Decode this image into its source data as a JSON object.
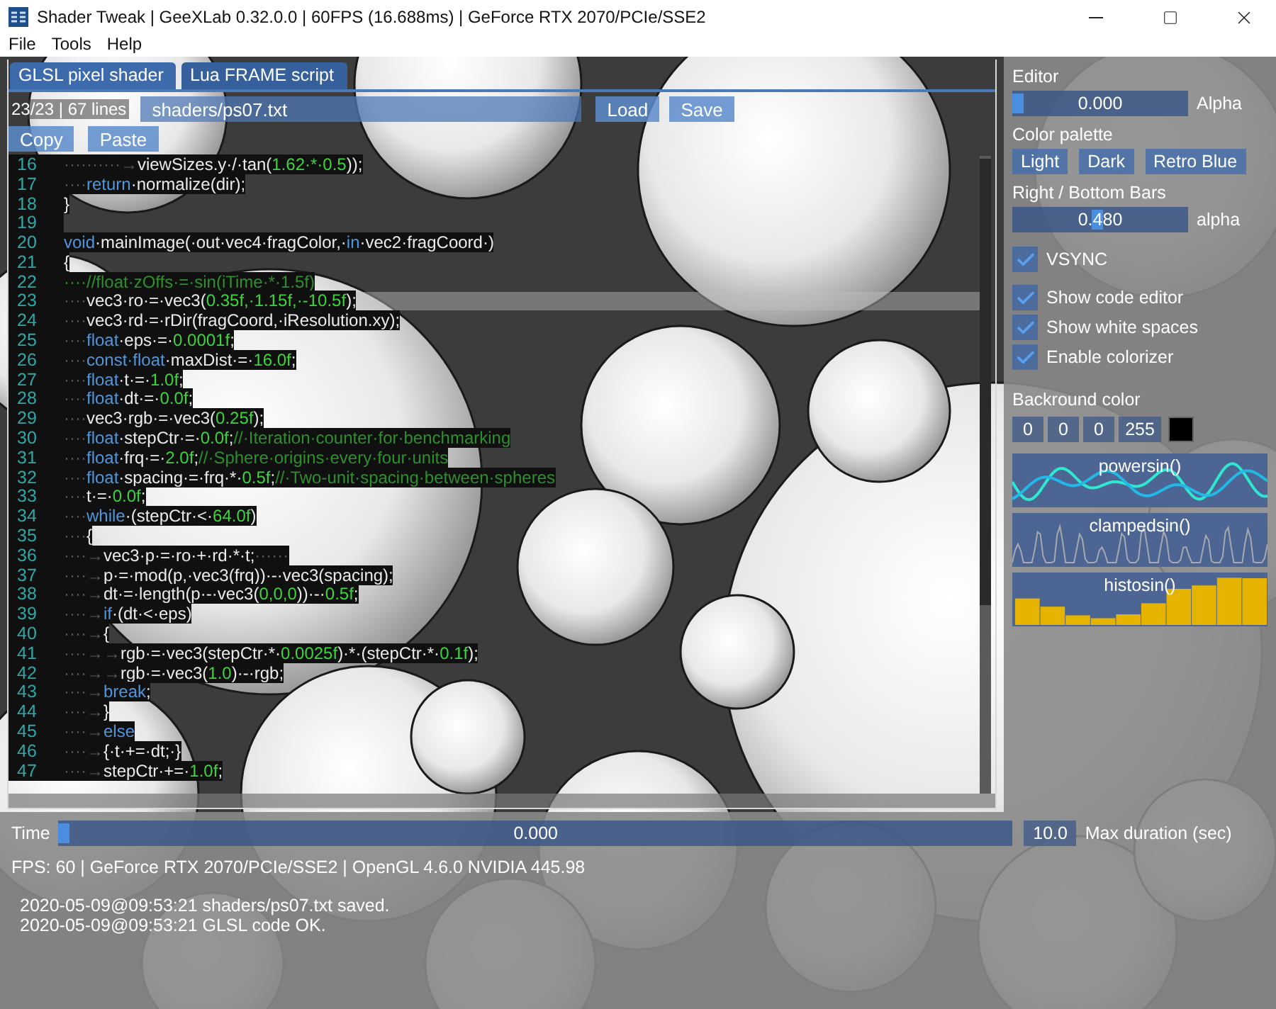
{
  "window": {
    "title": "Shader Tweak | GeeXLab 0.32.0.0 | 60FPS (16.688ms) | GeForce RTX 2070/PCIe/SSE2"
  },
  "menu": [
    "File",
    "Tools",
    "Help"
  ],
  "editor": {
    "tabs": [
      {
        "label": "GLSL pixel shader",
        "selected": true
      },
      {
        "label": "Lua FRAME script",
        "selected": false
      }
    ],
    "line_info": "23/23 | 67 lines",
    "file_path": "shaders/ps07.txt",
    "file_buttons": [
      "Load",
      "Save"
    ],
    "clipboard_buttons": [
      "Copy",
      "Paste"
    ],
    "lines": [
      {
        "n": "16",
        "selected": false,
        "tokens": [
          {
            "kind": "ws",
            "text": "··········→"
          },
          {
            "kind": "id",
            "text": "viewSizes.y·/·tan("
          },
          {
            "kind": "num",
            "text": "1.62·*·0.5"
          },
          {
            "kind": "id",
            "text": "));"
          }
        ]
      },
      {
        "n": "17",
        "selected": false,
        "tokens": [
          {
            "kind": "ws",
            "text": "····"
          },
          {
            "kind": "kw",
            "text": "return"
          },
          {
            "kind": "id",
            "text": "·normalize(dir);"
          }
        ]
      },
      {
        "n": "18",
        "selected": false,
        "tokens": [
          {
            "kind": "id",
            "text": "}"
          }
        ]
      },
      {
        "n": "19",
        "selected": false
      },
      {
        "n": "20",
        "selected": false,
        "tokens": [
          {
            "kind": "kw",
            "text": "void"
          },
          {
            "kind": "id",
            "text": "·mainImage(·out·vec4·fragColor,·"
          },
          {
            "kind": "kw",
            "text": "in"
          },
          {
            "kind": "id",
            "text": "·vec2·fragCoord·)"
          }
        ]
      },
      {
        "n": "21",
        "selected": false,
        "tokens": [
          {
            "kind": "id",
            "text": "{"
          }
        ]
      },
      {
        "n": "22",
        "selected": false,
        "tokens": [
          {
            "kind": "cm",
            "text": "····//float·zOffs·=·sin(iTime·*·1.5f)"
          }
        ]
      },
      {
        "n": "23",
        "selected": true,
        "tokens": [
          {
            "kind": "ws",
            "text": "····"
          },
          {
            "kind": "id",
            "text": "vec3·ro·=·vec3("
          },
          {
            "kind": "num",
            "text": "0.35f,·1.15f,·-10.5f"
          },
          {
            "kind": "id",
            "text": ");"
          }
        ]
      },
      {
        "n": "24",
        "selected": false,
        "tokens": [
          {
            "kind": "ws",
            "text": "····"
          },
          {
            "kind": "id",
            "text": "vec3·rd·=·rDir(fragCoord,·iResolution.xy);"
          }
        ]
      },
      {
        "n": "25",
        "selected": false,
        "tokens": [
          {
            "kind": "ws",
            "text": "····"
          },
          {
            "kind": "kw",
            "text": "float"
          },
          {
            "kind": "id",
            "text": "·eps·=·"
          },
          {
            "kind": "num",
            "text": "0.0001f"
          },
          {
            "kind": "id",
            "text": ";"
          }
        ]
      },
      {
        "n": "26",
        "selected": false,
        "tokens": [
          {
            "kind": "ws",
            "text": "····"
          },
          {
            "kind": "kw",
            "text": "const·float"
          },
          {
            "kind": "id",
            "text": "·maxDist·=·"
          },
          {
            "kind": "num",
            "text": "16.0f"
          },
          {
            "kind": "id",
            "text": ";"
          }
        ]
      },
      {
        "n": "27",
        "selected": false,
        "tokens": [
          {
            "kind": "ws",
            "text": "····"
          },
          {
            "kind": "kw",
            "text": "float"
          },
          {
            "kind": "id",
            "text": "·t·=·"
          },
          {
            "kind": "num",
            "text": "1.0f"
          },
          {
            "kind": "id",
            "text": ";"
          }
        ]
      },
      {
        "n": "28",
        "selected": false,
        "tokens": [
          {
            "kind": "ws",
            "text": "····"
          },
          {
            "kind": "kw",
            "text": "float"
          },
          {
            "kind": "id",
            "text": "·dt·=·"
          },
          {
            "kind": "num",
            "text": "0.0f"
          },
          {
            "kind": "id",
            "text": ";"
          }
        ]
      },
      {
        "n": "29",
        "selected": false,
        "tokens": [
          {
            "kind": "ws",
            "text": "····"
          },
          {
            "kind": "id",
            "text": "vec3·rgb·=·vec3("
          },
          {
            "kind": "num",
            "text": "0.25f"
          },
          {
            "kind": "id",
            "text": ");"
          }
        ]
      },
      {
        "n": "30",
        "selected": false,
        "tokens": [
          {
            "kind": "ws",
            "text": "····"
          },
          {
            "kind": "kw",
            "text": "float"
          },
          {
            "kind": "id",
            "text": "·stepCtr·=·"
          },
          {
            "kind": "num",
            "text": "0.0f"
          },
          {
            "kind": "id",
            "text": ";"
          },
          {
            "kind": "cm",
            "text": "//·Iteration·counter·for·benchmarking"
          }
        ]
      },
      {
        "n": "31",
        "selected": false,
        "tokens": [
          {
            "kind": "ws",
            "text": "····"
          },
          {
            "kind": "kw",
            "text": "float"
          },
          {
            "kind": "id",
            "text": "·frq·=·"
          },
          {
            "kind": "num",
            "text": "2.0f"
          },
          {
            "kind": "id",
            "text": ";"
          },
          {
            "kind": "cm",
            "text": "//·Sphere·origins·every·four·units"
          }
        ]
      },
      {
        "n": "32",
        "selected": false,
        "tokens": [
          {
            "kind": "ws",
            "text": "····"
          },
          {
            "kind": "kw",
            "text": "float"
          },
          {
            "kind": "id",
            "text": "·spacing·=·frq·*·"
          },
          {
            "kind": "num",
            "text": "0.5f"
          },
          {
            "kind": "id",
            "text": ";"
          },
          {
            "kind": "cm",
            "text": "//·Two-unit·spacing·between·spheres"
          }
        ]
      },
      {
        "n": "33",
        "selected": false,
        "tokens": [
          {
            "kind": "ws",
            "text": "····"
          },
          {
            "kind": "id",
            "text": "t·=·"
          },
          {
            "kind": "num",
            "text": "0.0f"
          },
          {
            "kind": "id",
            "text": ";"
          }
        ]
      },
      {
        "n": "34",
        "selected": false,
        "tokens": [
          {
            "kind": "ws",
            "text": "····"
          },
          {
            "kind": "kw",
            "text": "while"
          },
          {
            "kind": "id",
            "text": "·(stepCtr·<·"
          },
          {
            "kind": "num",
            "text": "64.0f"
          },
          {
            "kind": "id",
            "text": ")"
          }
        ]
      },
      {
        "n": "35",
        "selected": false,
        "tokens": [
          {
            "kind": "ws",
            "text": "····"
          },
          {
            "kind": "id",
            "text": "{"
          }
        ]
      },
      {
        "n": "36",
        "selected": false,
        "tokens": [
          {
            "kind": "ws",
            "text": "····→"
          },
          {
            "kind": "id",
            "text": "vec3·p·=·ro·+·rd·*·t;"
          },
          {
            "kind": "ws",
            "text": "······"
          }
        ]
      },
      {
        "n": "37",
        "selected": false,
        "tokens": [
          {
            "kind": "ws",
            "text": "····→"
          },
          {
            "kind": "id",
            "text": "p·=·mod(p,·vec3(frq))·-·vec3(spacing);"
          }
        ]
      },
      {
        "n": "38",
        "selected": false,
        "tokens": [
          {
            "kind": "ws",
            "text": "····→"
          },
          {
            "kind": "id",
            "text": "dt·=·length(p·-·vec3("
          },
          {
            "kind": "num",
            "text": "0,0,0"
          },
          {
            "kind": "id",
            "text": "))·-·"
          },
          {
            "kind": "num",
            "text": "0.5f"
          },
          {
            "kind": "id",
            "text": ";"
          }
        ]
      },
      {
        "n": "39",
        "selected": false,
        "tokens": [
          {
            "kind": "ws",
            "text": "····→"
          },
          {
            "kind": "kw",
            "text": "if"
          },
          {
            "kind": "id",
            "text": "·(dt·<·eps)"
          }
        ]
      },
      {
        "n": "40",
        "selected": false,
        "tokens": [
          {
            "kind": "ws",
            "text": "····→"
          },
          {
            "kind": "id",
            "text": "{"
          }
        ]
      },
      {
        "n": "41",
        "selected": false,
        "tokens": [
          {
            "kind": "ws",
            "text": "····→→"
          },
          {
            "kind": "id",
            "text": "rgb·=·vec3(stepCtr·*·"
          },
          {
            "kind": "num",
            "text": "0.0025f"
          },
          {
            "kind": "id",
            "text": ")·*·(stepCtr·*·"
          },
          {
            "kind": "num",
            "text": "0.1f"
          },
          {
            "kind": "id",
            "text": ");"
          }
        ]
      },
      {
        "n": "42",
        "selected": false,
        "tokens": [
          {
            "kind": "ws",
            "text": "····→→"
          },
          {
            "kind": "id",
            "text": "rgb·=·vec3("
          },
          {
            "kind": "num",
            "text": "1.0"
          },
          {
            "kind": "id",
            "text": ")·-·rgb;"
          }
        ]
      },
      {
        "n": "43",
        "selected": false,
        "tokens": [
          {
            "kind": "ws",
            "text": "····→"
          },
          {
            "kind": "kw",
            "text": "break"
          },
          {
            "kind": "id",
            "text": ";"
          }
        ]
      },
      {
        "n": "44",
        "selected": false,
        "tokens": [
          {
            "kind": "ws",
            "text": "····→"
          },
          {
            "kind": "id",
            "text": "}"
          }
        ]
      },
      {
        "n": "45",
        "selected": false,
        "tokens": [
          {
            "kind": "ws",
            "text": "····→"
          },
          {
            "kind": "kw",
            "text": "else"
          }
        ]
      },
      {
        "n": "46",
        "selected": false,
        "tokens": [
          {
            "kind": "ws",
            "text": "····→"
          },
          {
            "kind": "id",
            "text": "{·t·+=·dt;·}"
          }
        ]
      },
      {
        "n": "47",
        "selected": false,
        "tokens": [
          {
            "kind": "ws",
            "text": "····→"
          },
          {
            "kind": "id",
            "text": "stepCtr·+=·"
          },
          {
            "kind": "num",
            "text": "1.0f"
          },
          {
            "kind": "id",
            "text": ";"
          }
        ]
      }
    ]
  },
  "settings": {
    "editor_title": "Editor",
    "alpha": {
      "value": "0.000",
      "level": 0,
      "label": "Alpha"
    },
    "palette_title": "Color palette",
    "palettes": [
      "Light",
      "Dark",
      "Retro Blue"
    ],
    "bars_title": "Right / Bottom Bars",
    "bars_alpha": {
      "value": "0.480",
      "level": 0.48,
      "label": "alpha"
    },
    "options": [
      {
        "label": "VSYNC",
        "checked": true
      },
      {
        "label": "Show code editor",
        "checked": true
      },
      {
        "label": "Show white spaces",
        "checked": true
      },
      {
        "label": "Enable colorizer",
        "checked": true
      }
    ],
    "background_title": "Backround color",
    "background_rgba": [
      "0",
      "0",
      "0",
      "255"
    ],
    "plots": [
      {
        "kind": "powersin",
        "label": "powersin()"
      },
      {
        "kind": "clampedsin",
        "label": "clampedsin()"
      },
      {
        "kind": "histosin",
        "label": "histosin()"
      }
    ]
  },
  "timeline": {
    "label": "Time",
    "value": "0.000",
    "level": 0,
    "max_duration": "10.0",
    "max_label": "Max duration (sec)"
  },
  "status": "FPS: 60 | GeForce RTX 2070/PCIe/SSE2 | OpenGL 4.6.0 NVIDIA 445.98",
  "log": [
    "2020-05-09@09:53:21 shaders/ps07.txt saved.",
    "2020-05-09@09:53:21 GLSL code OK."
  ]
}
